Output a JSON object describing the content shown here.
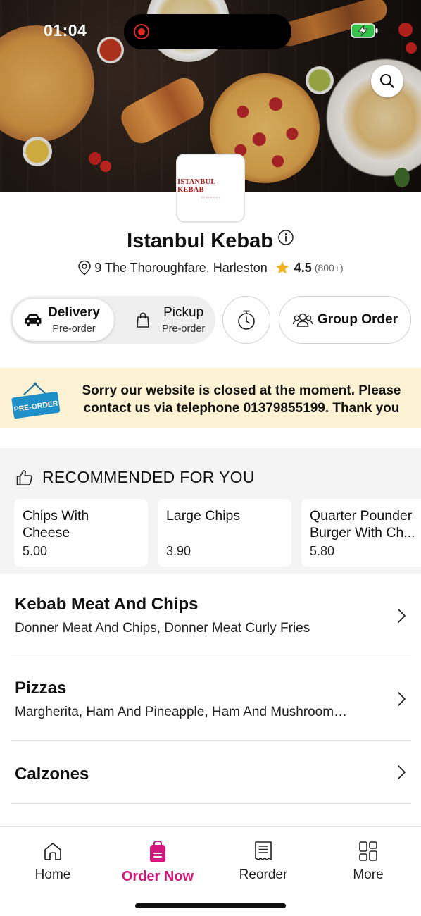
{
  "status_bar": {
    "time": "01:04"
  },
  "restaurant": {
    "logo_text": "ISTANBUL KEBAB",
    "name": "Istanbul Kebab",
    "address": "9 The Thoroughfare, Harleston",
    "rating": "4.5",
    "rating_count": "(800+)"
  },
  "order_mode": {
    "delivery": {
      "label": "Delivery",
      "sub": "Pre-order",
      "selected": true
    },
    "pickup": {
      "label": "Pickup",
      "sub": "Pre-order",
      "selected": false
    }
  },
  "group_order_label": "Group Order",
  "banner": {
    "sign_text": "PRE-ORDER",
    "message": "Sorry our website is closed at the moment. Please contact us via telephone 01379855199. Thank you"
  },
  "recommended": {
    "title": "RECOMMENDED FOR YOU",
    "items": [
      {
        "name": "Chips With Cheese",
        "price": "5.00"
      },
      {
        "name": "Large Chips",
        "price": "3.90"
      },
      {
        "name": "Quarter Pounder Burger With Ch...",
        "price": "5.80"
      }
    ]
  },
  "categories": [
    {
      "name": "Kebab Meat And Chips",
      "desc": "Donner Meat And Chips, Donner Meat Curly Fries"
    },
    {
      "name": "Pizzas",
      "desc": "Margherita, Ham And Pineapple, Ham And Mushroom…"
    },
    {
      "name": "Calzones",
      "desc": ""
    }
  ],
  "bottom_nav": [
    {
      "label": "Home",
      "icon": "home-icon",
      "active": false
    },
    {
      "label": "Order Now",
      "icon": "order-bag-icon",
      "active": true
    },
    {
      "label": "Reorder",
      "icon": "receipt-icon",
      "active": false
    },
    {
      "label": "More",
      "icon": "grid-icon",
      "active": false
    }
  ],
  "colors": {
    "accent": "#d2177d",
    "banner_bg": "#fdf3d4",
    "star": "#f2b01e",
    "logo_red": "#b3201c",
    "sign_blue": "#1f8fc7"
  }
}
